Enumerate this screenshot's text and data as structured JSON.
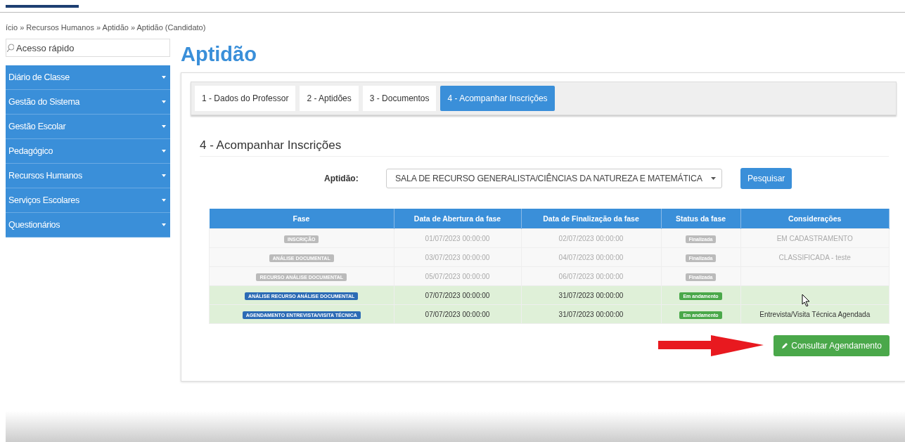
{
  "breadcrumb": "ício » Recursos Humanos » Aptidão » Aptidão (Candidato)",
  "search": {
    "placeholder": "Acesso rápido"
  },
  "sidebar": {
    "items": [
      {
        "label": "Diário de Classe"
      },
      {
        "label": "Gestão do Sistema"
      },
      {
        "label": "Gestão Escolar"
      },
      {
        "label": "Pedagógico"
      },
      {
        "label": "Recursos Humanos"
      },
      {
        "label": "Serviços Escolares"
      },
      {
        "label": "Questionários"
      }
    ]
  },
  "page_title": "Aptidão",
  "tabs": [
    {
      "label": "1 - Dados do Professor",
      "selected": false
    },
    {
      "label": "2 - Aptidões",
      "selected": false
    },
    {
      "label": "3 - Documentos",
      "selected": false
    },
    {
      "label": "4 - Acompanhar Inscrições",
      "selected": true
    }
  ],
  "section_title": "4 - Acompanhar Inscrições",
  "filter": {
    "label": "Aptidão:",
    "value": "SALA DE RECURSO GENERALISTA/CIÊNCIAS DA NATUREZA E MATEMÁTICA",
    "button": "Pesquisar"
  },
  "table": {
    "columns": [
      "Fase",
      "Data de Abertura da fase",
      "Data de Finalização da fase",
      "Status da fase",
      "Considerações"
    ],
    "rows": [
      {
        "kind": "finished",
        "phase": "INSCRIÇÃO",
        "opened": "01/07/2023 00:00:00",
        "closed": "02/07/2023 00:00:00",
        "status": "Finalizada",
        "notes": "EM CADASTRAMENTO"
      },
      {
        "kind": "finished",
        "phase": "ANÁLISE DOCUMENTAL",
        "opened": "03/07/2023 00:00:00",
        "closed": "04/07/2023 00:00:00",
        "status": "Finalizada",
        "notes": "CLASSIFICADA - teste"
      },
      {
        "kind": "finished",
        "phase": "RECURSO ANÁLISE DOCUMENTAL",
        "opened": "05/07/2023 00:00:00",
        "closed": "06/07/2023 00:00:00",
        "status": "Finalizada"
      },
      {
        "kind": "active",
        "phase": "ANÁLISE RECURSO ANÁLISE DOCUMENTAL",
        "opened": "07/07/2023 00:00:00",
        "closed": "31/07/2023 00:00:00",
        "status": "Em andamento"
      },
      {
        "kind": "active",
        "phase": "AGENDAMENTO ENTREVISTA/VISITA TÉCNICA",
        "opened": "07/07/2023 00:00:00",
        "closed": "31/07/2023 00:00:00",
        "status": "Em andamento",
        "notes": "Entrevista/Visita Técnica Agendada"
      }
    ]
  },
  "action_button": "Consultar Agendamento"
}
